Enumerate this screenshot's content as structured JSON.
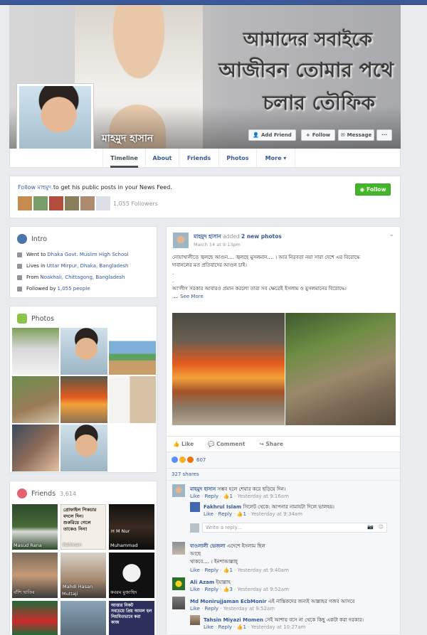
{
  "cover": {
    "lines": [
      "আমাদের সবাইকে",
      "আজীবন তোমার পথে",
      "চলার তৌফিক"
    ],
    "name": "মাহমুদ হাসান",
    "buttons": {
      "add_friend": "Add Friend",
      "follow": "Follow",
      "message": "Message",
      "more": "···"
    }
  },
  "tabs": [
    "Timeline",
    "About",
    "Friends",
    "Photos",
    "More ▾"
  ],
  "follow_box": {
    "prefix": "Follow",
    "name": "মাহমুদ",
    "suffix": "to get his public posts in your News Feed.",
    "button": "Follow",
    "followers": "1,055 Followers"
  },
  "intro": {
    "title": "Intro",
    "items": [
      {
        "label": "Went to",
        "link": "Dhaka Govt. Muslim High School"
      },
      {
        "label": "Lives in",
        "link": "Uttar Mirpur, Dhaka, Bangladesh"
      },
      {
        "label": "From",
        "link": "Noakhali, Chittagong, Bangladesh"
      },
      {
        "label": "Followed by",
        "link": "1,055 people"
      }
    ]
  },
  "photos": {
    "title": "Photos"
  },
  "friends": {
    "title": "Friends",
    "count": "3,614",
    "items": [
      {
        "name": "Masud Rana",
        "caption": ""
      },
      {
        "name": "Rohman",
        "caption": "প্রোফাইল পিকচার\nবদলে দিন।\nশুকরিয়ে গেলে\nতাকেও নিন!"
      },
      {
        "name": "Muhammad",
        "caption": "H M Nur"
      },
      {
        "name": "বাঁশি খাতিব",
        "caption": ""
      },
      {
        "name": "Muttaji",
        "caption": "Mahdi Hasan"
      },
      {
        "name": "কবরম মুজাহিদ",
        "caption": ""
      },
      {
        "name": "",
        "caption": ""
      },
      {
        "name": "",
        "caption": ""
      },
      {
        "name": "",
        "caption": "আত্তার নিকট\nসবচেয়ে প্রিয় আমল হল\nনিয়মিতভাবে করা\nকাজ"
      }
    ]
  },
  "post": {
    "author": "মাহমুদ হাসান",
    "action": "added",
    "photos_link": "2 new photos",
    "date": "March 14 at 9:13pm",
    "text1": "নোয়াখালীতে জ্বলছে আগুন.... জ্বলছে মুসলমান.... । আর নিরবতা নয়া সারা দেশে এর বিরোদ্ধে",
    "text2": "দাবানলের মত প্রতিবাদের আগুন চাই।",
    "text3": "আ'লীগ সরকার আবারও প্রমান করলো তারা সব ক্ষেত্রেই ইসলাম ও মুসলমানের বিরোদ্ধে।",
    "see_more": "See More",
    "like": "Like",
    "comment": "Comment",
    "share": "Share",
    "reactions": "607",
    "shares": "327 shares",
    "comments": [
      {
        "author": "মাহমুদ হাসান",
        "text": "সম্ভব হলে শেয়ার করে ছড়িয়ে দিন।",
        "likes": "1",
        "time": "Yesterday at 9:16am"
      },
      {
        "author": "Fakhrul Islam",
        "text": "সিলেট থেকে: আপনার নামাযটা দিলে ভালহয়।",
        "likes": "1",
        "time": "Yesterday at 9:34am"
      },
      {
        "author": "বাওলালী ভেজলা",
        "text": "এদেশে ইসলাম ছিল",
        "text_b": "আছে",
        "text_c": "থাকবে.... । ইনশাআল্লাহ্‌",
        "likes": "1",
        "time": "Yesterday at 9:40am"
      },
      {
        "author": "Ali Azam",
        "text": "ইয়াল্লাহ",
        "likes": "3",
        "time": "Yesterday at 9:52am"
      },
      {
        "author": "Md Monirujjaman EcbMonir",
        "text": "এই নাস্তিকদের জন্যই আল্লাহর গজব আসবে",
        "likes": "",
        "time": "Yesterday at 9:52am"
      },
      {
        "author": "Tahsin Miyazi Momen",
        "text": "সেই আশায় বসে না থেকে কিছু একটা করা দরকার।",
        "likes": "1",
        "time": "Yesterday at 10:27am"
      }
    ],
    "write_reply": "Write a reply...",
    "reply": "Reply",
    "like_small": "Like"
  }
}
